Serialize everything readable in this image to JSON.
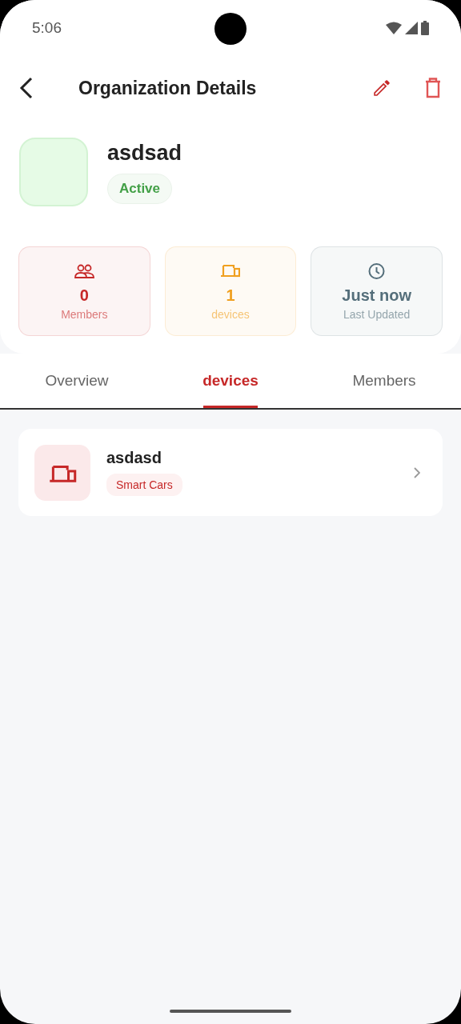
{
  "status_bar": {
    "time": "5:06"
  },
  "header": {
    "title": "Organization Details"
  },
  "organization": {
    "name": "asdsad",
    "status": "Active"
  },
  "stats": [
    {
      "kind": "members",
      "value": "0",
      "label": "Members",
      "color": "#c62828"
    },
    {
      "kind": "devices",
      "value": "1",
      "label": "devices",
      "color": "#f0a020"
    },
    {
      "kind": "updated",
      "value": "Just now",
      "label": "Last Updated",
      "color": "#546e7a"
    }
  ],
  "tabs": [
    {
      "label": "Overview",
      "selected": false
    },
    {
      "label": "devices",
      "selected": true
    },
    {
      "label": "Members",
      "selected": false
    }
  ],
  "devices": [
    {
      "name": "asdasd",
      "category": "Smart Cars"
    }
  ]
}
